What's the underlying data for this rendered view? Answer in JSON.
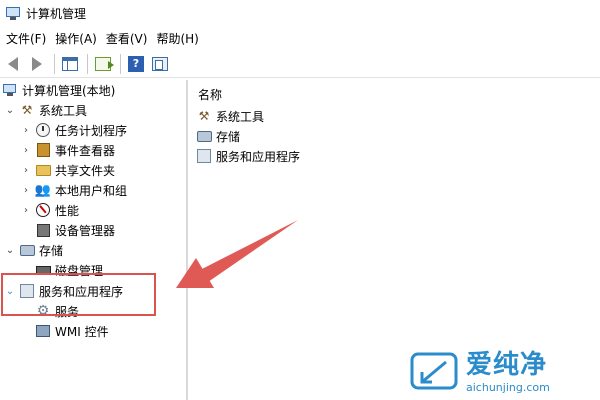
{
  "window": {
    "title": "计算机管理"
  },
  "menu": [
    "文件(F)",
    "操作(A)",
    "查看(V)",
    "帮助(H)"
  ],
  "toolbar": {
    "help_glyph": "?"
  },
  "tree": {
    "root": "计算机管理(本地)",
    "system_tools": "系统工具",
    "task_scheduler": "任务计划程序",
    "event_viewer": "事件查看器",
    "shared_folders": "共享文件夹",
    "local_users": "本地用户和组",
    "performance": "性能",
    "device_manager": "设备管理器",
    "storage": "存储",
    "disk_management": "磁盘管理",
    "services_apps": "服务和应用程序",
    "services": "服务",
    "wmi": "WMI 控件"
  },
  "twisty": {
    "expanded": "⌄",
    "collapsed": "›"
  },
  "right": {
    "column_header": "名称",
    "items": [
      "系统工具",
      "存储",
      "服务和应用程序"
    ]
  },
  "annotation": {
    "highlight_color": "#d9534f"
  },
  "watermark": {
    "brand": "爱纯净",
    "url": "aichunjing.com"
  },
  "colors": {
    "accent": "#2b8ccc"
  }
}
